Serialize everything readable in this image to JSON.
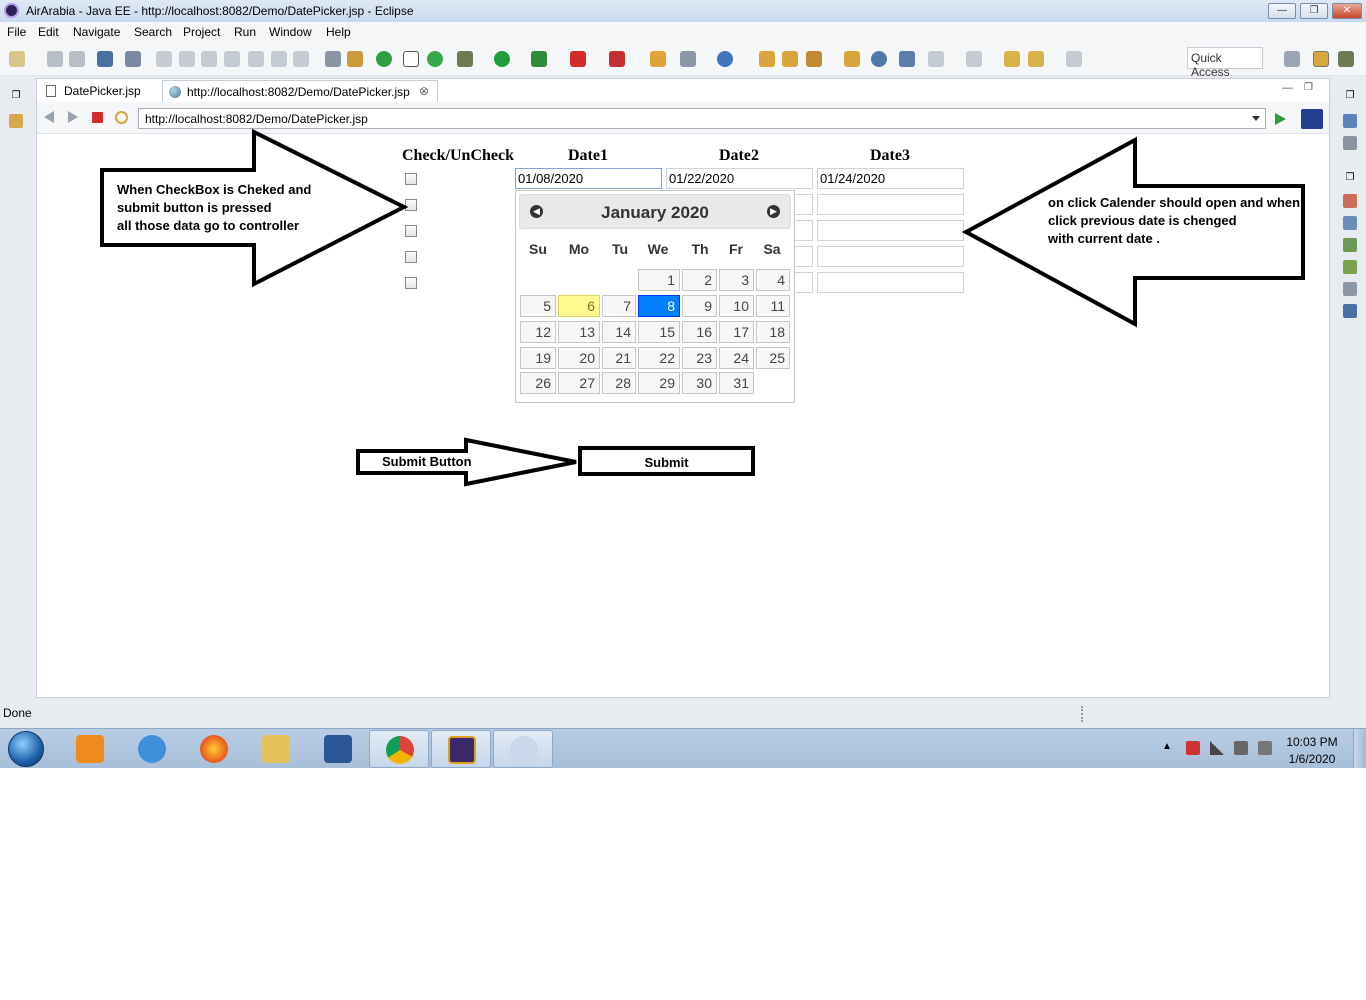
{
  "window": {
    "title": "AirArabia - Java EE - http://localhost:8082/Demo/DatePicker.jsp - Eclipse"
  },
  "menu": [
    "File",
    "Edit",
    "Navigate",
    "Search",
    "Project",
    "Run",
    "Window",
    "Help"
  ],
  "quick_access": "Quick Access",
  "tabs": [
    {
      "label": "DatePicker.jsp"
    },
    {
      "label": "http://localhost:8082/Demo/DatePicker.jsp"
    }
  ],
  "browser": {
    "url": "http://localhost:8082/Demo/DatePicker.jsp"
  },
  "page": {
    "headers": [
      "Check/UnCheck",
      "Date1",
      "Date2",
      "Date3"
    ],
    "row1": {
      "date1": "01/08/2020",
      "date2": "01/22/2020",
      "date3": "01/24/2020"
    },
    "submit_label": "Submit"
  },
  "calendar": {
    "month_label": "January 2020",
    "weekdays": [
      "Su",
      "Mo",
      "Tu",
      "We",
      "Th",
      "Fr",
      "Sa"
    ],
    "weeks": [
      [
        "",
        "",
        "",
        "1",
        "2",
        "3",
        "4"
      ],
      [
        "5",
        "6",
        "7",
        "8",
        "9",
        "10",
        "11"
      ],
      [
        "12",
        "13",
        "14",
        "15",
        "16",
        "17",
        "18"
      ],
      [
        "19",
        "20",
        "21",
        "22",
        "23",
        "24",
        "25"
      ],
      [
        "26",
        "27",
        "28",
        "29",
        "30",
        "31",
        ""
      ]
    ],
    "today": "6",
    "selected": "8"
  },
  "annotations": {
    "left": [
      "When CheckBox is Cheked and",
      "submit button is pressed",
      "all those data go to controller"
    ],
    "right": [
      "on click Calender should open and when",
      "click previous date is chenged",
      "with current date ."
    ],
    "submit": "Submit Button"
  },
  "status": {
    "text": "Done"
  },
  "taskbar": {
    "time": "10:03 PM",
    "date": "1/6/2020"
  },
  "colors": {
    "selected_day": "#007fff",
    "today_day": "#fffa90",
    "title_bar": "#dfe9f5",
    "taskbar": "#b8cde4"
  }
}
